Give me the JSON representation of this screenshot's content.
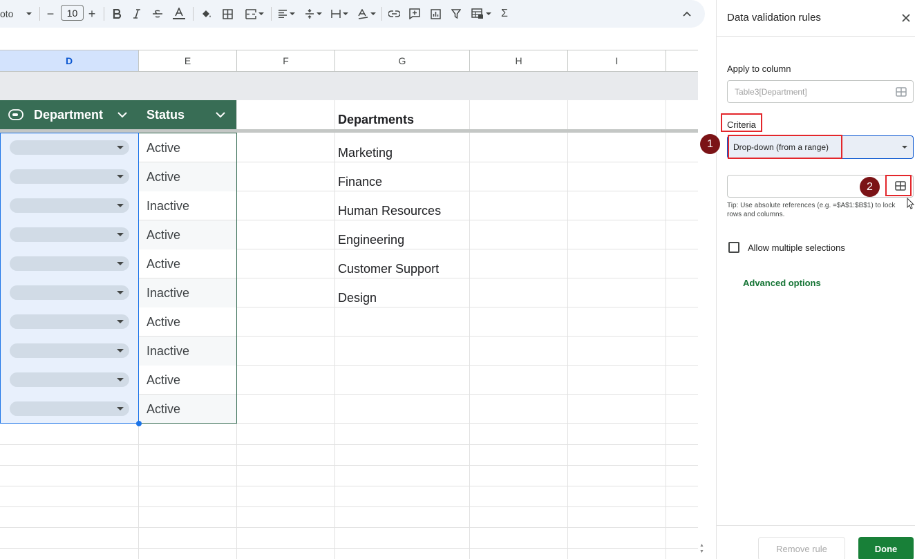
{
  "toolbar": {
    "font_name": "oto",
    "font_size": "10",
    "minus_label": "−",
    "plus_label": "+",
    "sum_label": "Σ"
  },
  "sheet": {
    "columns": [
      {
        "letter": "D"
      },
      {
        "letter": "E"
      },
      {
        "letter": "F"
      },
      {
        "letter": "G"
      },
      {
        "letter": "H"
      },
      {
        "letter": "I"
      }
    ],
    "table": {
      "department_header": "Department",
      "status_header": "Status",
      "status_values": [
        "Active",
        "Active",
        "Inactive",
        "Active",
        "Active",
        "Inactive",
        "Active",
        "Inactive",
        "Active",
        "Active"
      ],
      "header_color": "#386d55"
    },
    "departments": {
      "title": "Departments",
      "items": [
        "Marketing",
        "Finance",
        "Human Resources",
        "Engineering",
        "Customer Support",
        "Design"
      ]
    }
  },
  "panel": {
    "title": "Data validation rules",
    "close_icon": "close-icon",
    "apply_label": "Apply to column",
    "apply_value": "Table3[Department]",
    "criteria_label": "Criteria",
    "criteria_value": "Drop-down (from a range)",
    "range_value": "",
    "tip": "Tip: Use absolute references (e.g. =$A$1:$B$1) to lock rows and columns.",
    "allow_multiple_label": "Allow multiple selections",
    "allow_multiple_checked": false,
    "advanced_options": "Advanced options",
    "remove_rule": "Remove rule",
    "done": "Done",
    "accent_color": "#188038"
  },
  "annotations": {
    "marker_1": "1",
    "marker_2": "2",
    "highlight_color": "#e3262b"
  }
}
